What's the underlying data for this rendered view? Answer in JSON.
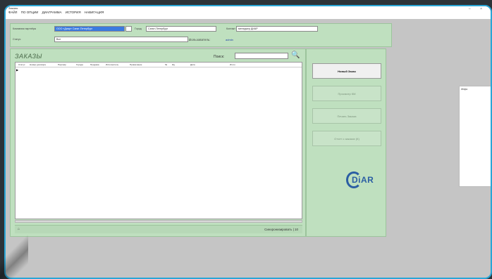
{
  "window": {
    "title": "Заказы",
    "controls": "– ×"
  },
  "menu": [
    "ФАЙЛ",
    "ПО ОПЦИИ",
    "ДИАГРАММА",
    "ИСТОРИЯ",
    "НАВИГАЦИЯ"
  ],
  "filters": {
    "org_label": "Компания партнёра",
    "org_value": "ООО «Диар» Санкт-Петербург",
    "city_label": "Город",
    "city_value": "Санкт-Петербург",
    "contact_label": "Контакт",
    "contact_value": "менеджер ДИАР",
    "status_label": "Статус",
    "status_value": "Все",
    "user_label": "Пользователь:",
    "user_link": "admin"
  },
  "orders": {
    "section_title": "ЗАКАЗЫ",
    "search_label": "Поиск:",
    "search_value": "",
    "columns": [
      "Статус",
      "Номер договора",
      "Партнёр",
      "Города",
      "Продажа",
      "Исполнитель",
      "Примечание",
      "№",
      "Ид",
      "Дата",
      "Итого"
    ],
    "row_marker": "▶",
    "status_left": "⌂",
    "status_right": "Синхронизировать | 10"
  },
  "actions": {
    "new_order": "Новый Заказ",
    "view": "Просмотр КМ",
    "print": "Печать Заказа",
    "report": "Отчет о заказах (К)"
  },
  "logo_text": "DiAR",
  "popup": {
    "label": "Инфо"
  }
}
